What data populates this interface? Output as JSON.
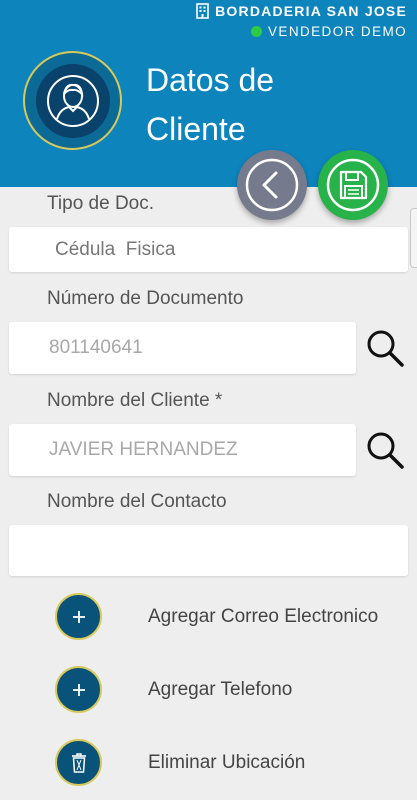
{
  "header": {
    "company": "BORDADERIA SAN JOSE",
    "vendor": "VENDEDOR DEMO",
    "title_line1": "Datos de",
    "title_line2": "Cliente"
  },
  "form": {
    "doc_type_label": "Tipo de Doc.",
    "doc_type_value": "Cédula  Fisica",
    "doc_number_label": "Número de Documento",
    "doc_number_value": "801140641",
    "client_name_label": "Nombre del Cliente *",
    "client_name_value": "JAVIER HERNANDEZ",
    "contact_name_label": "Nombre del Contacto",
    "contact_name_value": ""
  },
  "actions": {
    "add_email": "Agregar Correo Electronico",
    "add_phone": "Agregar Telefono",
    "delete_location": "Eliminar Ubicación"
  },
  "colors": {
    "header": "#0e84bd",
    "save": "#27b24a",
    "back": "#757b8c",
    "action_circle": "#09537a",
    "accent_ring": "#d8c95a"
  },
  "icons": [
    "building-icon",
    "status-dot-icon",
    "user-avatar-icon",
    "back-arrow-icon",
    "save-floppy-icon",
    "search-icon",
    "plus-icon",
    "trash-icon"
  ]
}
